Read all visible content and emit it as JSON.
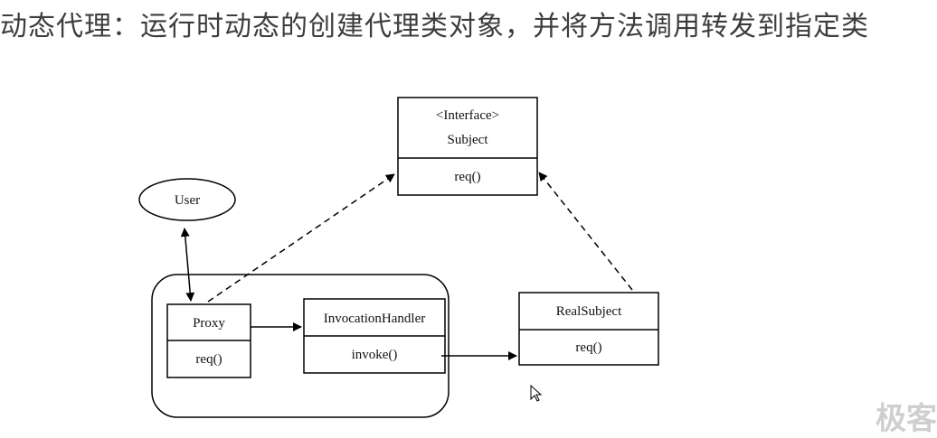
{
  "title": "动态代理：运行时动态的创建代理类对象，并将方法调用转发到指定类",
  "diagram": {
    "subject": {
      "stereotype": "<Interface>",
      "name": "Subject",
      "method": "req()"
    },
    "user": {
      "name": "User"
    },
    "proxy": {
      "name": "Proxy",
      "method": "req()"
    },
    "handler": {
      "name": "InvocationHandler",
      "method": "invoke()"
    },
    "realsubject": {
      "name": "RealSubject",
      "method": "req()"
    }
  },
  "watermark": "极客"
}
